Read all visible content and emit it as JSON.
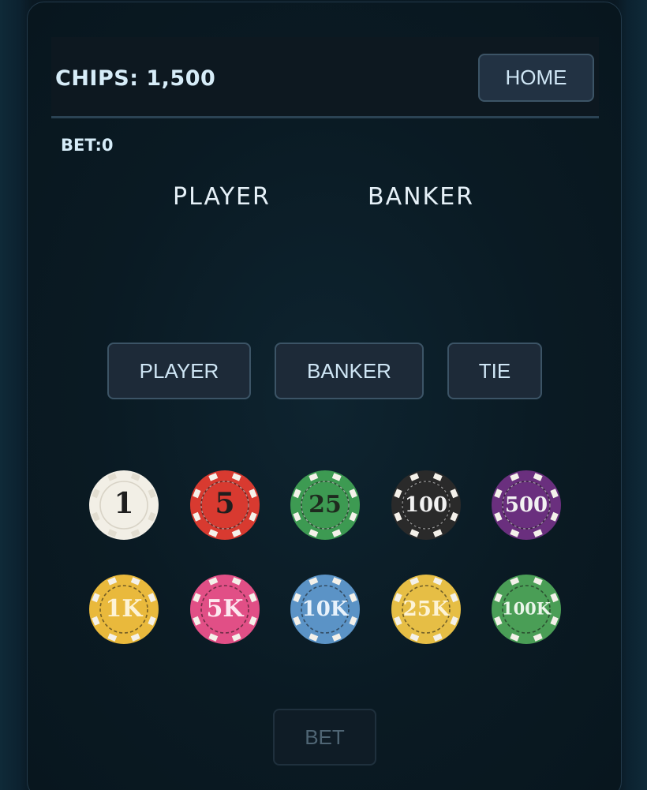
{
  "header": {
    "chips_label": "CHIPS: 1,500",
    "home_label": "HOME"
  },
  "bet": {
    "amount_label": "BET:0"
  },
  "hands": {
    "player_label": "PLAYER",
    "banker_label": "BANKER"
  },
  "bet_options": {
    "player_label": "PLAYER",
    "banker_label": "BANKER",
    "tie_label": "TIE"
  },
  "chips": [
    {
      "label": "1",
      "color": "#f2efe6",
      "text_color": "#1e1e1e"
    },
    {
      "label": "5",
      "color": "#d83a30",
      "text_color": "#1e1e1e"
    },
    {
      "label": "25",
      "color": "#3d9a52",
      "text_color": "#1e2a1e"
    },
    {
      "label": "100",
      "color": "#2a2a2a",
      "text_color": "#f2f2f2"
    },
    {
      "label": "500",
      "color": "#6a2f7e",
      "text_color": "#f2f2f2"
    },
    {
      "label": "1K",
      "color": "#e9b93c",
      "text_color": "#fdf3d6"
    },
    {
      "label": "5K",
      "color": "#e14f86",
      "text_color": "#fde8f0"
    },
    {
      "label": "10K",
      "color": "#5b93c6",
      "text_color": "#e8f2fb"
    },
    {
      "label": "25K",
      "color": "#e6be45",
      "text_color": "#fdf3d6"
    },
    {
      "label": "100K",
      "color": "#4a9e56",
      "text_color": "#eaf6ea"
    }
  ],
  "actions": {
    "bet_label": "BET"
  }
}
